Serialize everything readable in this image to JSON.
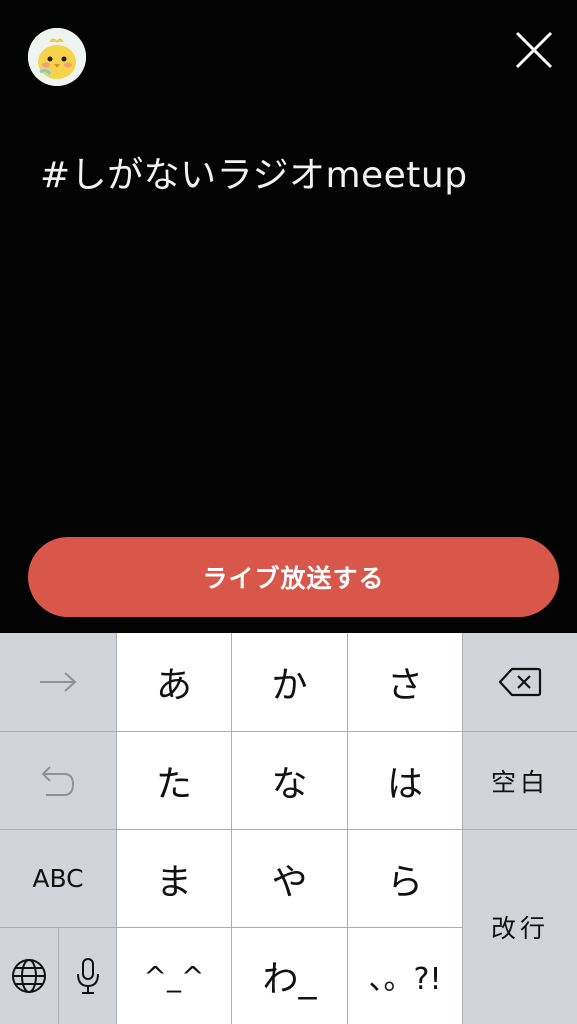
{
  "header": {
    "title": "#しがないラジオmeetup"
  },
  "actions": {
    "live_button": "ライブ放送する"
  },
  "keyboard": {
    "rows": [
      [
        "あ",
        "か",
        "さ"
      ],
      [
        "た",
        "な",
        "は"
      ],
      [
        "ま",
        "や",
        "ら"
      ],
      [
        "^_^",
        "わ_",
        "、。?!"
      ]
    ],
    "abc": "ABC",
    "space": "空白",
    "enter": "改行"
  },
  "icons": {
    "avatar": "chick-avatar-icon",
    "close": "close-icon",
    "next": "arrow-right-icon",
    "undo": "undo-icon",
    "delete": "backspace-icon",
    "globe": "globe-icon",
    "mic": "microphone-icon"
  },
  "colors": {
    "background": "#030303",
    "accent": "#d9574a",
    "keyboard_bg": "#d1d4d9",
    "key_white": "#ffffff"
  }
}
